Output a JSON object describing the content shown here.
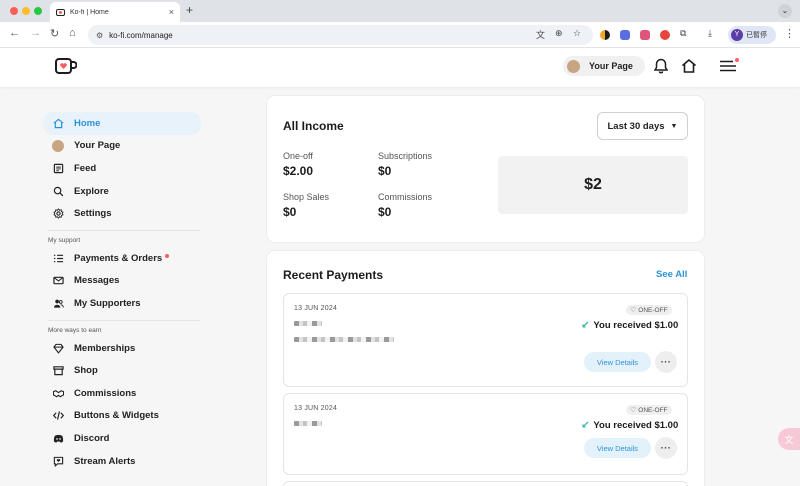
{
  "browser": {
    "tab_title": "Ko-fi | Home",
    "tab_close": "×",
    "new_tab": "+",
    "url": "ko-fi.com/manage",
    "profile_initial": "Y",
    "profile_label": "已暫停"
  },
  "header": {
    "your_page_label": "Your Page",
    "brand_color": "#ff5e5b"
  },
  "sidebar": {
    "main_items": [
      {
        "label": "Home",
        "icon": "home-icon",
        "active": true
      },
      {
        "label": "Your Page",
        "icon": "avatar"
      },
      {
        "label": "Feed",
        "icon": "feed-icon"
      },
      {
        "label": "Explore",
        "icon": "search-icon"
      },
      {
        "label": "Settings",
        "icon": "gear-icon"
      }
    ],
    "support_label": "My support",
    "support_items": [
      {
        "label": "Payments & Orders",
        "icon": "list-icon",
        "notification": true
      },
      {
        "label": "Messages",
        "icon": "mail-icon"
      },
      {
        "label": "My Supporters",
        "icon": "users-icon"
      }
    ],
    "earn_label": "More ways to earn",
    "earn_items": [
      {
        "label": "Memberships",
        "icon": "diamond-icon"
      },
      {
        "label": "Shop",
        "icon": "shop-icon"
      },
      {
        "label": "Commissions",
        "icon": "handshake-icon"
      },
      {
        "label": "Buttons & Widgets",
        "icon": "code-icon"
      },
      {
        "label": "Discord",
        "icon": "discord-icon"
      },
      {
        "label": "Stream Alerts",
        "icon": "alert-icon"
      }
    ]
  },
  "income": {
    "title": "All Income",
    "range": "Last 30 days",
    "stats": {
      "one_off_label": "One-off",
      "one_off_value": "$2.00",
      "subscriptions_label": "Subscriptions",
      "subscriptions_value": "$0",
      "shop_label": "Shop Sales",
      "shop_value": "$0",
      "commissions_label": "Commissions",
      "commissions_value": "$0"
    },
    "total": "$2"
  },
  "payments": {
    "title": "Recent Payments",
    "see_all": "See All",
    "items": [
      {
        "date": "13 JUN 2024",
        "badge": "ONE-OFF",
        "received": "You received $1.00",
        "view": "View Details",
        "more": "···"
      },
      {
        "date": "13 JUN 2024",
        "badge": "ONE-OFF",
        "received": "You received $1.00",
        "view": "View Details",
        "more": "···"
      }
    ]
  }
}
